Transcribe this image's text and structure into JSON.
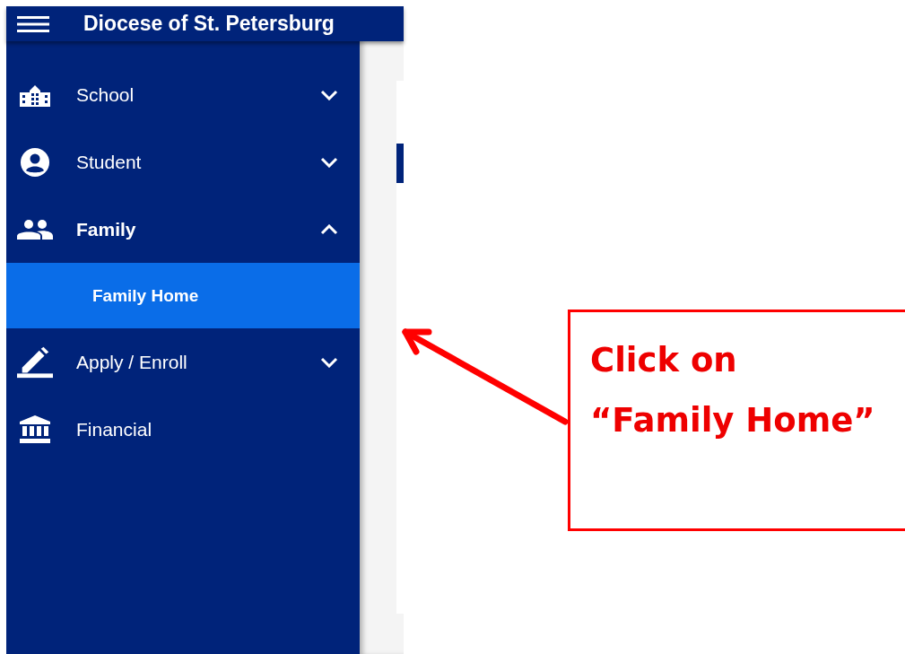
{
  "app_bar": {
    "title": "Diocese of St. Petersburg"
  },
  "sidebar": {
    "items": [
      {
        "label": "School",
        "kind": "group",
        "expanded": false
      },
      {
        "label": "Student",
        "kind": "group",
        "expanded": false
      },
      {
        "label": "Family",
        "kind": "group",
        "expanded": true,
        "children": [
          {
            "label": "Family Home",
            "selected": true
          }
        ]
      },
      {
        "label": "Apply / Enroll",
        "kind": "group",
        "expanded": false
      },
      {
        "label": "Financial",
        "kind": "link"
      }
    ]
  },
  "callout": {
    "text": "Click on “Family Home”"
  }
}
